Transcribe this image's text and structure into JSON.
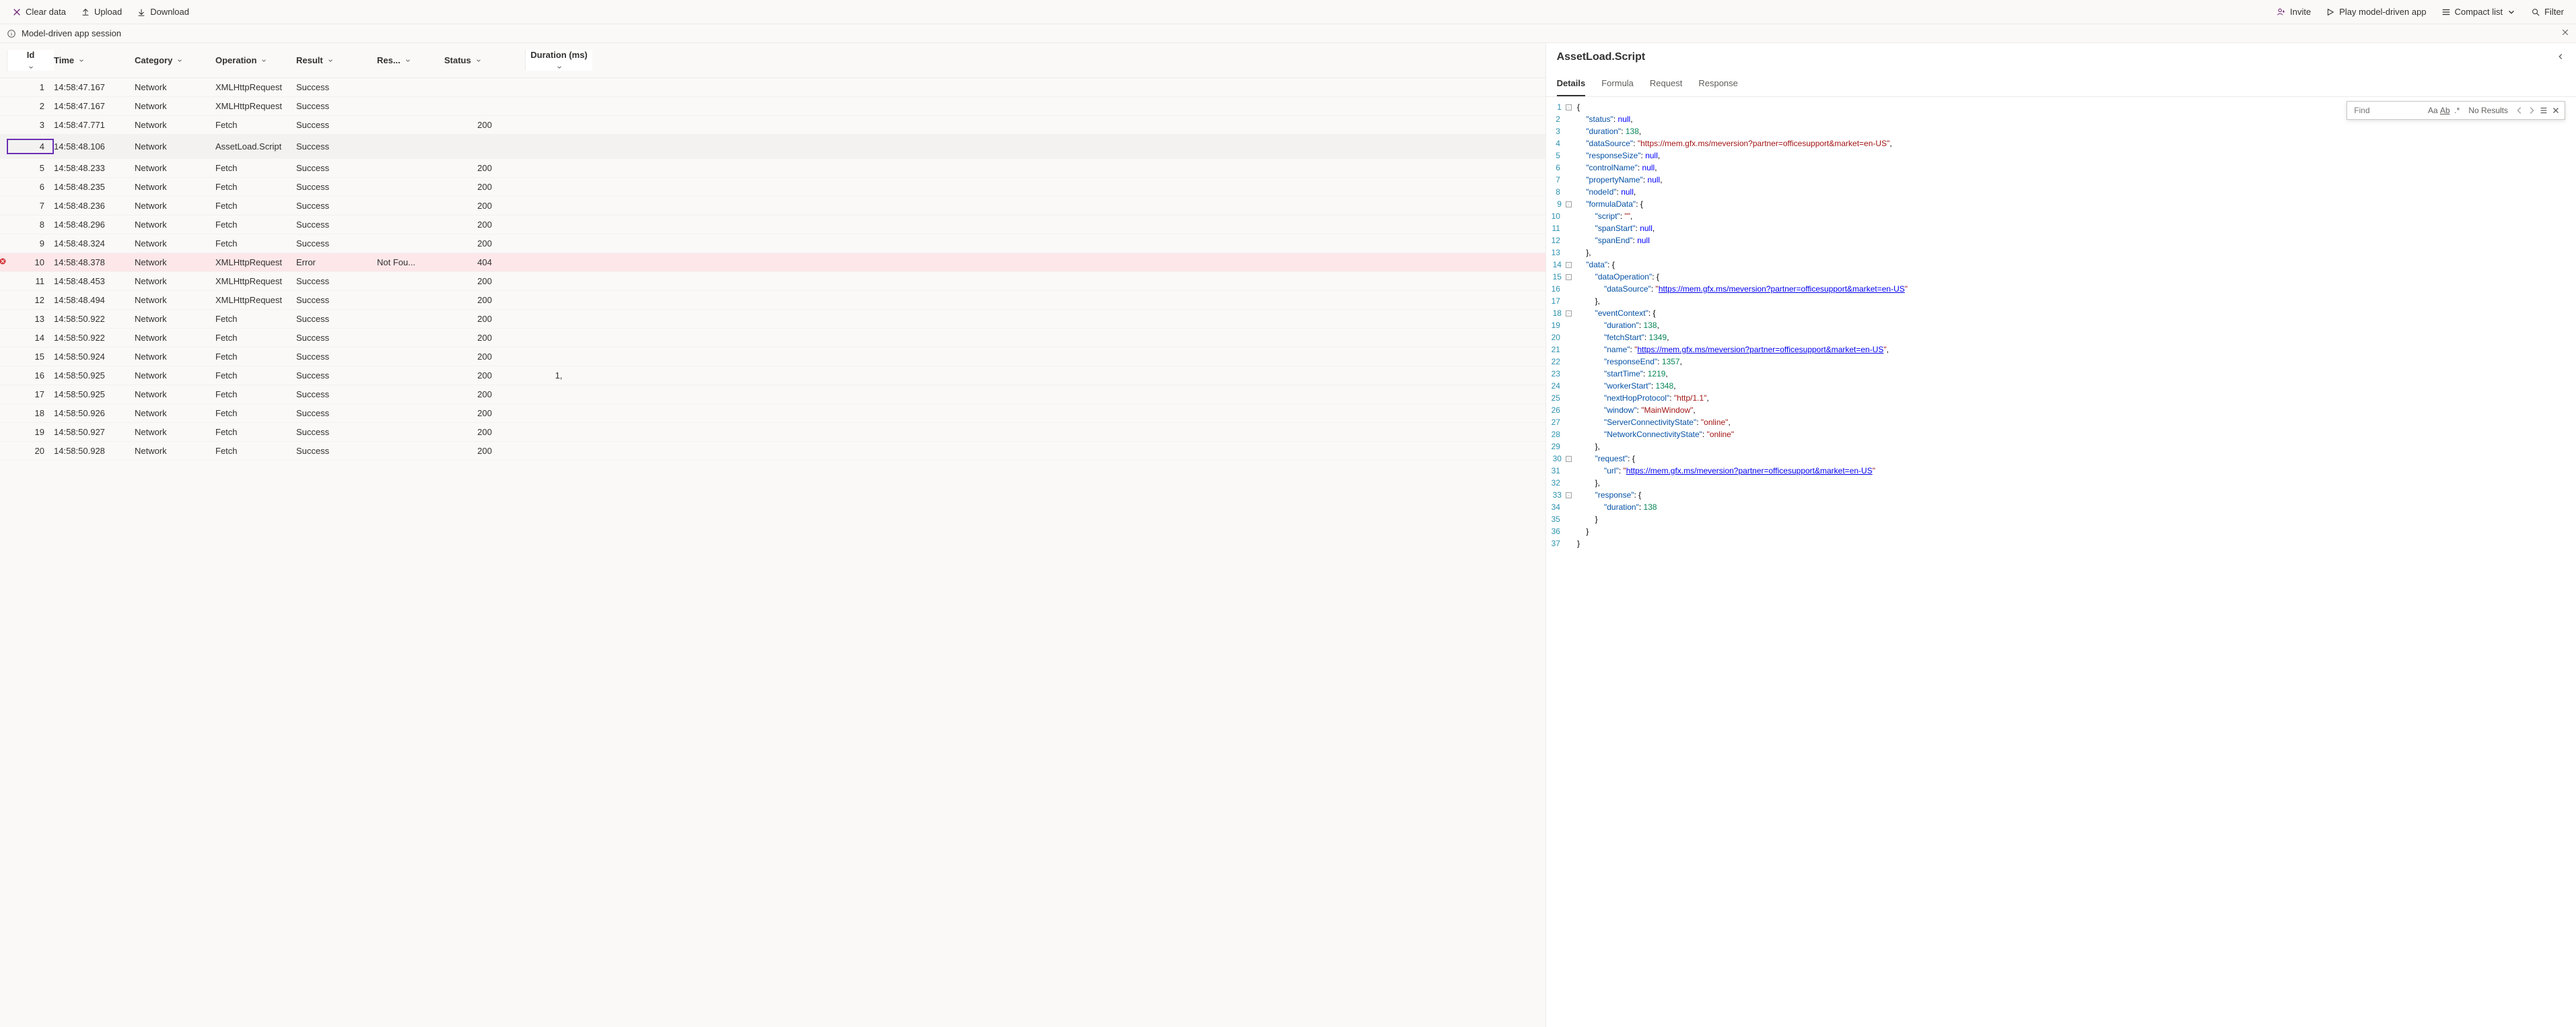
{
  "toolbar": {
    "clear": "Clear data",
    "upload": "Upload",
    "download": "Download",
    "invite": "Invite",
    "play": "Play model-driven app",
    "compact": "Compact list",
    "filter": "Filter"
  },
  "session": {
    "label": "Model-driven app session"
  },
  "columns": {
    "id": "Id",
    "time": "Time",
    "category": "Category",
    "operation": "Operation",
    "result": "Result",
    "res": "Res...",
    "status": "Status",
    "duration": "Duration (ms)"
  },
  "rows": [
    {
      "id": "1",
      "time": "14:58:47.167",
      "category": "Network",
      "operation": "XMLHttpRequest",
      "result": "Success",
      "res": "",
      "status": "",
      "dur": "",
      "error": false,
      "selected": false
    },
    {
      "id": "2",
      "time": "14:58:47.167",
      "category": "Network",
      "operation": "XMLHttpRequest",
      "result": "Success",
      "res": "",
      "status": "",
      "dur": "",
      "error": false,
      "selected": false
    },
    {
      "id": "3",
      "time": "14:58:47.771",
      "category": "Network",
      "operation": "Fetch",
      "result": "Success",
      "res": "",
      "status": "200",
      "dur": "",
      "error": false,
      "selected": false
    },
    {
      "id": "4",
      "time": "14:58:48.106",
      "category": "Network",
      "operation": "AssetLoad.Script",
      "result": "Success",
      "res": "",
      "status": "",
      "dur": "",
      "error": false,
      "selected": true
    },
    {
      "id": "5",
      "time": "14:58:48.233",
      "category": "Network",
      "operation": "Fetch",
      "result": "Success",
      "res": "",
      "status": "200",
      "dur": "",
      "error": false,
      "selected": false
    },
    {
      "id": "6",
      "time": "14:58:48.235",
      "category": "Network",
      "operation": "Fetch",
      "result": "Success",
      "res": "",
      "status": "200",
      "dur": "",
      "error": false,
      "selected": false
    },
    {
      "id": "7",
      "time": "14:58:48.236",
      "category": "Network",
      "operation": "Fetch",
      "result": "Success",
      "res": "",
      "status": "200",
      "dur": "",
      "error": false,
      "selected": false
    },
    {
      "id": "8",
      "time": "14:58:48.296",
      "category": "Network",
      "operation": "Fetch",
      "result": "Success",
      "res": "",
      "status": "200",
      "dur": "",
      "error": false,
      "selected": false
    },
    {
      "id": "9",
      "time": "14:58:48.324",
      "category": "Network",
      "operation": "Fetch",
      "result": "Success",
      "res": "",
      "status": "200",
      "dur": "",
      "error": false,
      "selected": false
    },
    {
      "id": "10",
      "time": "14:58:48.378",
      "category": "Network",
      "operation": "XMLHttpRequest",
      "result": "Error",
      "res": "Not Fou...",
      "status": "404",
      "dur": "",
      "error": true,
      "selected": false
    },
    {
      "id": "11",
      "time": "14:58:48.453",
      "category": "Network",
      "operation": "XMLHttpRequest",
      "result": "Success",
      "res": "",
      "status": "200",
      "dur": "",
      "error": false,
      "selected": false
    },
    {
      "id": "12",
      "time": "14:58:48.494",
      "category": "Network",
      "operation": "XMLHttpRequest",
      "result": "Success",
      "res": "",
      "status": "200",
      "dur": "",
      "error": false,
      "selected": false
    },
    {
      "id": "13",
      "time": "14:58:50.922",
      "category": "Network",
      "operation": "Fetch",
      "result": "Success",
      "res": "",
      "status": "200",
      "dur": "",
      "error": false,
      "selected": false
    },
    {
      "id": "14",
      "time": "14:58:50.922",
      "category": "Network",
      "operation": "Fetch",
      "result": "Success",
      "res": "",
      "status": "200",
      "dur": "",
      "error": false,
      "selected": false
    },
    {
      "id": "15",
      "time": "14:58:50.924",
      "category": "Network",
      "operation": "Fetch",
      "result": "Success",
      "res": "",
      "status": "200",
      "dur": "",
      "error": false,
      "selected": false
    },
    {
      "id": "16",
      "time": "14:58:50.925",
      "category": "Network",
      "operation": "Fetch",
      "result": "Success",
      "res": "",
      "status": "200",
      "dur": "1,",
      "error": false,
      "selected": false
    },
    {
      "id": "17",
      "time": "14:58:50.925",
      "category": "Network",
      "operation": "Fetch",
      "result": "Success",
      "res": "",
      "status": "200",
      "dur": "",
      "error": false,
      "selected": false
    },
    {
      "id": "18",
      "time": "14:58:50.926",
      "category": "Network",
      "operation": "Fetch",
      "result": "Success",
      "res": "",
      "status": "200",
      "dur": "",
      "error": false,
      "selected": false
    },
    {
      "id": "19",
      "time": "14:58:50.927",
      "category": "Network",
      "operation": "Fetch",
      "result": "Success",
      "res": "",
      "status": "200",
      "dur": "",
      "error": false,
      "selected": false
    },
    {
      "id": "20",
      "time": "14:58:50.928",
      "category": "Network",
      "operation": "Fetch",
      "result": "Success",
      "res": "",
      "status": "200",
      "dur": "",
      "error": false,
      "selected": false
    }
  ],
  "details": {
    "title": "AssetLoad.Script",
    "tabs": {
      "details": "Details",
      "formula": "Formula",
      "request": "Request",
      "response": "Response"
    }
  },
  "find": {
    "placeholder": "Find",
    "result": "No Results"
  },
  "code": [
    {
      "n": 1,
      "fold": "-",
      "html": "<span class='tok-punc'>{</span>"
    },
    {
      "n": 2,
      "fold": "",
      "html": "    <span class='tok-key'>\"status\"</span><span class='tok-punc'>: </span><span class='tok-null'>null</span><span class='tok-punc'>,</span>"
    },
    {
      "n": 3,
      "fold": "",
      "html": "    <span class='tok-key'>\"duration\"</span><span class='tok-punc'>: </span><span class='tok-num'>138</span><span class='tok-punc'>,</span>"
    },
    {
      "n": 4,
      "fold": "",
      "html": "    <span class='tok-key'>\"dataSource\"</span><span class='tok-punc'>: </span><span class='tok-str'>\"https://mem.gfx.ms/meversion?partner=officesupport&amp;market=en-US\"</span><span class='tok-punc'>,</span>"
    },
    {
      "n": 5,
      "fold": "",
      "html": "    <span class='tok-key'>\"responseSize\"</span><span class='tok-punc'>: </span><span class='tok-null'>null</span><span class='tok-punc'>,</span>"
    },
    {
      "n": 6,
      "fold": "",
      "html": "    <span class='tok-key'>\"controlName\"</span><span class='tok-punc'>: </span><span class='tok-null'>null</span><span class='tok-punc'>,</span>"
    },
    {
      "n": 7,
      "fold": "",
      "html": "    <span class='tok-key'>\"propertyName\"</span><span class='tok-punc'>: </span><span class='tok-null'>null</span><span class='tok-punc'>,</span>"
    },
    {
      "n": 8,
      "fold": "",
      "html": "    <span class='tok-key'>\"nodeId\"</span><span class='tok-punc'>: </span><span class='tok-null'>null</span><span class='tok-punc'>,</span>"
    },
    {
      "n": 9,
      "fold": "-",
      "html": "    <span class='tok-key'>\"formulaData\"</span><span class='tok-punc'>: {</span>"
    },
    {
      "n": 10,
      "fold": "",
      "html": "        <span class='tok-key'>\"script\"</span><span class='tok-punc'>: </span><span class='tok-str'>\"\"</span><span class='tok-punc'>,</span>"
    },
    {
      "n": 11,
      "fold": "",
      "html": "        <span class='tok-key'>\"spanStart\"</span><span class='tok-punc'>: </span><span class='tok-null'>null</span><span class='tok-punc'>,</span>"
    },
    {
      "n": 12,
      "fold": "",
      "html": "        <span class='tok-key'>\"spanEnd\"</span><span class='tok-punc'>: </span><span class='tok-null'>null</span>"
    },
    {
      "n": 13,
      "fold": "",
      "html": "    <span class='tok-punc'>},</span>"
    },
    {
      "n": 14,
      "fold": "-",
      "html": "    <span class='tok-key'>\"data\"</span><span class='tok-punc'>: {</span>"
    },
    {
      "n": 15,
      "fold": "-",
      "html": "        <span class='tok-key'>\"dataOperation\"</span><span class='tok-punc'>: {</span>"
    },
    {
      "n": 16,
      "fold": "",
      "html": "            <span class='tok-key'>\"dataSource\"</span><span class='tok-punc'>: </span><span class='tok-str'>\"<span class='tok-url'>https://mem.gfx.ms/meversion?partner=officesupport&amp;market=en-US</span>\"</span>"
    },
    {
      "n": 17,
      "fold": "",
      "html": "        <span class='tok-punc'>},</span>"
    },
    {
      "n": 18,
      "fold": "-",
      "html": "        <span class='tok-key'>\"eventContext\"</span><span class='tok-punc'>: {</span>"
    },
    {
      "n": 19,
      "fold": "",
      "html": "            <span class='tok-key'>\"duration\"</span><span class='tok-punc'>: </span><span class='tok-num'>138</span><span class='tok-punc'>,</span>"
    },
    {
      "n": 20,
      "fold": "",
      "html": "            <span class='tok-key'>\"fetchStart\"</span><span class='tok-punc'>: </span><span class='tok-num'>1349</span><span class='tok-punc'>,</span>"
    },
    {
      "n": 21,
      "fold": "",
      "html": "            <span class='tok-key'>\"name\"</span><span class='tok-punc'>: </span><span class='tok-str'>\"<span class='tok-url'>https://mem.gfx.ms/meversion?partner=officesupport&amp;market=en-US</span>\"</span><span class='tok-punc'>,</span>"
    },
    {
      "n": 22,
      "fold": "",
      "html": "            <span class='tok-key'>\"responseEnd\"</span><span class='tok-punc'>: </span><span class='tok-num'>1357</span><span class='tok-punc'>,</span>"
    },
    {
      "n": 23,
      "fold": "",
      "html": "            <span class='tok-key'>\"startTime\"</span><span class='tok-punc'>: </span><span class='tok-num'>1219</span><span class='tok-punc'>,</span>"
    },
    {
      "n": 24,
      "fold": "",
      "html": "            <span class='tok-key'>\"workerStart\"</span><span class='tok-punc'>: </span><span class='tok-num'>1348</span><span class='tok-punc'>,</span>"
    },
    {
      "n": 25,
      "fold": "",
      "html": "            <span class='tok-key'>\"nextHopProtocol\"</span><span class='tok-punc'>: </span><span class='tok-str'>\"http/1.1\"</span><span class='tok-punc'>,</span>"
    },
    {
      "n": 26,
      "fold": "",
      "html": "            <span class='tok-key'>\"window\"</span><span class='tok-punc'>: </span><span class='tok-str'>\"MainWindow\"</span><span class='tok-punc'>,</span>"
    },
    {
      "n": 27,
      "fold": "",
      "html": "            <span class='tok-key'>\"ServerConnectivityState\"</span><span class='tok-punc'>: </span><span class='tok-str'>\"online\"</span><span class='tok-punc'>,</span>"
    },
    {
      "n": 28,
      "fold": "",
      "html": "            <span class='tok-key'>\"NetworkConnectivityState\"</span><span class='tok-punc'>: </span><span class='tok-str'>\"online\"</span>"
    },
    {
      "n": 29,
      "fold": "",
      "html": "        <span class='tok-punc'>},</span>"
    },
    {
      "n": 30,
      "fold": "-",
      "html": "        <span class='tok-key'>\"request\"</span><span class='tok-punc'>: {</span>"
    },
    {
      "n": 31,
      "fold": "",
      "html": "            <span class='tok-key'>\"url\"</span><span class='tok-punc'>: </span><span class='tok-str'>\"<span class='tok-url'>https://mem.gfx.ms/meversion?partner=officesupport&amp;market=en-US</span>\"</span>"
    },
    {
      "n": 32,
      "fold": "",
      "html": "        <span class='tok-punc'>},</span>"
    },
    {
      "n": 33,
      "fold": "-",
      "html": "        <span class='tok-key'>\"response\"</span><span class='tok-punc'>: {</span>"
    },
    {
      "n": 34,
      "fold": "",
      "html": "            <span class='tok-key'>\"duration\"</span><span class='tok-punc'>: </span><span class='tok-num'>138</span>"
    },
    {
      "n": 35,
      "fold": "",
      "html": "        <span class='tok-punc'>}</span>"
    },
    {
      "n": 36,
      "fold": "",
      "html": "    <span class='tok-punc'>}</span>"
    },
    {
      "n": 37,
      "fold": "",
      "html": "<span class='tok-punc'>}</span>"
    }
  ]
}
